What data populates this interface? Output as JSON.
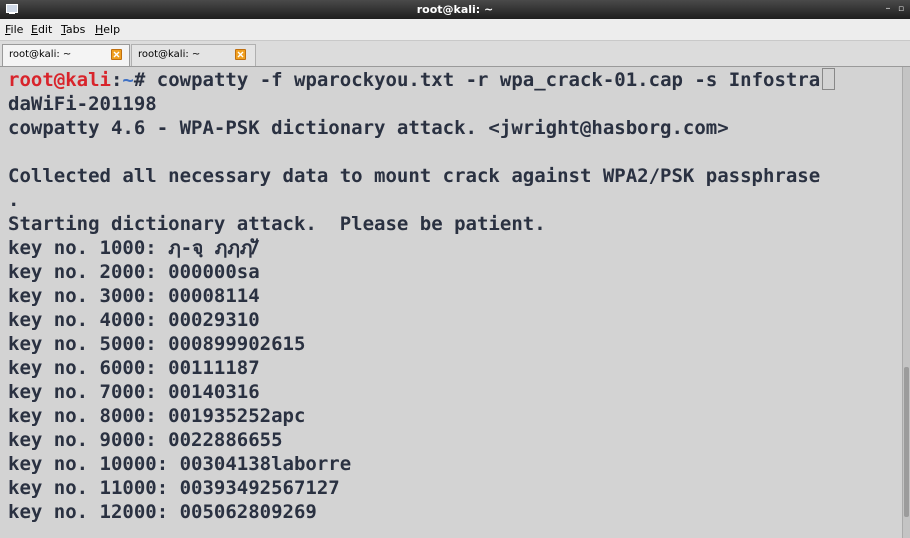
{
  "window": {
    "title": "root@kali: ~",
    "controls": {
      "minimize": "–",
      "maximize": "▫"
    }
  },
  "menu": {
    "file": {
      "mnemonic": "F",
      "rest": "ile"
    },
    "edit": {
      "mnemonic": "E",
      "rest": "dit"
    },
    "tabs": {
      "mnemonic": "T",
      "rest": "abs"
    },
    "help": {
      "mnemonic": "H",
      "rest": "elp"
    }
  },
  "tabs": [
    {
      "label": "root@kali: ~",
      "active": true
    },
    {
      "label": "root@kali: ~",
      "active": false
    }
  ],
  "terminal": {
    "prompt_user": "root@kali",
    "prompt_sep": ":",
    "prompt_path": "~",
    "prompt_symbol": "# ",
    "command": "cowpatty -f wparockyou.txt -r wpa_crack-01.cap -s Infostra",
    "lines": [
      "daWiFi-201198",
      "cowpatty 4.6 - WPA-PSK dictionary attack. <jwright@hasborg.com>",
      "",
      "Collected all necessary data to mount crack against WPA2/PSK passphrase",
      ".",
      "Starting dictionary attack.  Please be patient.",
      "key no. 1000: ฦ-จฺ ฦฦฦ/ั",
      "key no. 2000: 000000sa",
      "key no. 3000: 00008114",
      "key no. 4000: 00029310",
      "key no. 5000: 000899902615",
      "key no. 6000: 00111187",
      "key no. 7000: 00140316",
      "key no. 8000: 001935252apc",
      "key no. 9000: 0022886655",
      "key no. 10000: 00304138laborre",
      "key no. 11000: 00393492567127",
      "key no. 12000: 005062809269"
    ]
  },
  "colors": {
    "terminal_bg": "#d3d3d3",
    "terminal_fg": "#2a3141",
    "prompt_user": "#d8242b",
    "prompt_path": "#3f71c4",
    "tab_close": "#f0a020"
  }
}
